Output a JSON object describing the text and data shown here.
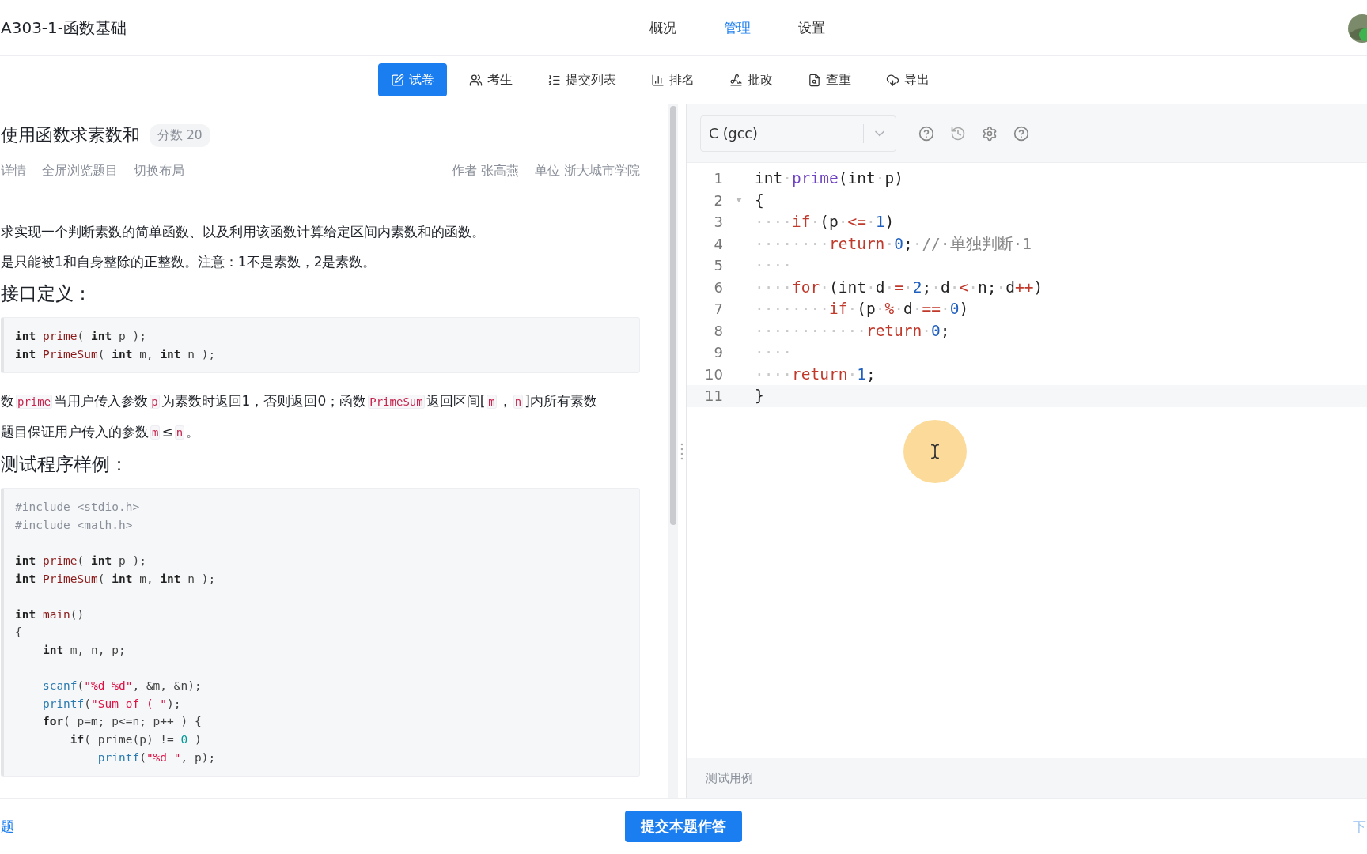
{
  "header": {
    "title": "A303-1-函数基础",
    "nav": [
      {
        "label": "概况",
        "selected": false
      },
      {
        "label": "管理",
        "selected": true
      },
      {
        "label": "设置",
        "selected": false
      }
    ]
  },
  "subnav": [
    {
      "label": "试卷",
      "selected": true
    },
    {
      "label": "考生",
      "selected": false
    },
    {
      "label": "提交列表",
      "selected": false
    },
    {
      "label": "排名",
      "selected": false
    },
    {
      "label": "批改",
      "selected": false
    },
    {
      "label": "查重",
      "selected": false
    },
    {
      "label": "导出",
      "selected": false
    }
  ],
  "problem": {
    "title": "使用函数求素数和",
    "score": "分数 20",
    "links": [
      "详情",
      "全屏浏览题目",
      "切换布局"
    ],
    "author": "作者 张高燕",
    "unit": "单位 浙大城市学院",
    "blocks": [
      {
        "kind": "para",
        "segments": [
          {
            "kind": "text",
            "s": "求实现一个判断素数的简单函数、以及利用该函数计算给定区间内素数和的函数。"
          }
        ]
      },
      {
        "kind": "para",
        "segments": [
          {
            "kind": "text",
            "s": "是只能被1和自身整除的正整数。注意：1不是素数，2是素数。"
          }
        ]
      },
      {
        "kind": "heading",
        "s": "接口定义："
      },
      {
        "kind": "code",
        "groups": [
          [
            [
              {
                "kind": "type",
                "s": "int"
              },
              {
                "kind": "name",
                "s": " prime"
              },
              {
                "kind": "plain",
                "s": "( "
              },
              {
                "kind": "type",
                "s": "int"
              },
              {
                "kind": "plain",
                "s": " p );"
              }
            ],
            [
              {
                "kind": "type",
                "s": "int"
              },
              {
                "kind": "name",
                "s": " PrimeSum"
              },
              {
                "kind": "plain",
                "s": "( "
              },
              {
                "kind": "type",
                "s": "int"
              },
              {
                "kind": "plain",
                "s": " m, "
              },
              {
                "kind": "type",
                "s": "int"
              },
              {
                "kind": "plain",
                "s": " n );"
              }
            ]
          ]
        ]
      },
      {
        "kind": "para",
        "segments": [
          {
            "kind": "text",
            "s": "数"
          },
          {
            "kind": "code",
            "s": "prime"
          },
          {
            "kind": "text",
            "s": "当用户传入参数"
          },
          {
            "kind": "code",
            "s": "p"
          },
          {
            "kind": "text",
            "s": "为素数时返回1，否则返回0；函数"
          },
          {
            "kind": "code",
            "s": "PrimeSum"
          },
          {
            "kind": "text",
            "s": "返回区间["
          },
          {
            "kind": "code",
            "s": "m"
          },
          {
            "kind": "text",
            "s": "，"
          },
          {
            "kind": "code",
            "s": "n"
          },
          {
            "kind": "text",
            "s": "]内所有素数"
          }
        ]
      },
      {
        "kind": "para",
        "segments": [
          {
            "kind": "text",
            "s": "题目保证用户传入的参数"
          },
          {
            "kind": "code",
            "s": "m"
          },
          {
            "kind": "text",
            "s": "≤"
          },
          {
            "kind": "code",
            "s": "n"
          },
          {
            "kind": "text",
            "s": "。"
          }
        ]
      },
      {
        "kind": "heading",
        "s": "测试程序样例："
      },
      {
        "kind": "code",
        "groups": [
          [
            [
              {
                "kind": "pre",
                "s": "#include <stdio.h>"
              }
            ],
            [
              {
                "kind": "pre",
                "s": "#include <math.h>"
              }
            ]
          ],
          [
            [
              {
                "kind": "type",
                "s": "int"
              },
              {
                "kind": "name",
                "s": " prime"
              },
              {
                "kind": "plain",
                "s": "( "
              },
              {
                "kind": "type",
                "s": "int"
              },
              {
                "kind": "plain",
                "s": " p );"
              }
            ],
            [
              {
                "kind": "type",
                "s": "int"
              },
              {
                "kind": "name",
                "s": " PrimeSum"
              },
              {
                "kind": "plain",
                "s": "( "
              },
              {
                "kind": "type",
                "s": "int"
              },
              {
                "kind": "plain",
                "s": " m, "
              },
              {
                "kind": "type",
                "s": "int"
              },
              {
                "kind": "plain",
                "s": " n );"
              }
            ]
          ],
          [
            [
              {
                "kind": "type",
                "s": "int"
              },
              {
                "kind": "name",
                "s": " main"
              },
              {
                "kind": "plain",
                "s": "()"
              }
            ],
            [
              {
                "kind": "plain",
                "s": "{"
              }
            ],
            [
              {
                "kind": "type",
                "s": "    int"
              },
              {
                "kind": "plain",
                "s": " m, n, p;"
              }
            ]
          ],
          [
            [
              {
                "kind": "builtin",
                "s": "    scanf"
              },
              {
                "kind": "plain",
                "s": "("
              },
              {
                "kind": "string",
                "s": "\"%d %d\""
              },
              {
                "kind": "plain",
                "s": ", &m, &n);"
              }
            ],
            [
              {
                "kind": "builtin",
                "s": "    printf"
              },
              {
                "kind": "plain",
                "s": "("
              },
              {
                "kind": "string",
                "s": "\"Sum of ( \""
              },
              {
                "kind": "plain",
                "s": ");"
              }
            ],
            [
              {
                "kind": "type",
                "s": "    for"
              },
              {
                "kind": "plain",
                "s": "( p=m; p<=n; p++ ) {"
              }
            ],
            [
              {
                "kind": "type",
                "s": "        if"
              },
              {
                "kind": "plain",
                "s": "( prime(p) != "
              },
              {
                "kind": "number",
                "s": "0"
              },
              {
                "kind": "plain",
                "s": " )"
              }
            ],
            [
              {
                "kind": "builtin",
                "s": "            printf"
              },
              {
                "kind": "plain",
                "s": "("
              },
              {
                "kind": "string",
                "s": "\"%d \""
              },
              {
                "kind": "plain",
                "s": ", p);"
              }
            ]
          ]
        ]
      }
    ]
  },
  "editor": {
    "language": "C (gcc)",
    "lines": [
      {
        "n": "1",
        "fold": false,
        "active": false,
        "tokens": [
          {
            "kind": "plain",
            "s": "int"
          },
          {
            "kind": "space",
            "s": "·"
          },
          {
            "kind": "name",
            "s": "prime"
          },
          {
            "kind": "plain",
            "s": "(int"
          },
          {
            "kind": "space",
            "s": "·"
          },
          {
            "kind": "plain",
            "s": "p)"
          }
        ]
      },
      {
        "n": "2",
        "fold": true,
        "active": false,
        "tokens": [
          {
            "kind": "plain",
            "s": "{"
          }
        ]
      },
      {
        "n": "3",
        "fold": false,
        "active": false,
        "tokens": [
          {
            "kind": "space",
            "s": "····"
          },
          {
            "kind": "keyword",
            "s": "if"
          },
          {
            "kind": "space",
            "s": "·"
          },
          {
            "kind": "plain",
            "s": "(p"
          },
          {
            "kind": "space",
            "s": "·"
          },
          {
            "kind": "keyword",
            "s": "<="
          },
          {
            "kind": "space",
            "s": "·"
          },
          {
            "kind": "number",
            "s": "1"
          },
          {
            "kind": "plain",
            "s": ")"
          }
        ]
      },
      {
        "n": "4",
        "fold": false,
        "active": false,
        "tokens": [
          {
            "kind": "space",
            "s": "········"
          },
          {
            "kind": "keyword",
            "s": "return"
          },
          {
            "kind": "space",
            "s": "·"
          },
          {
            "kind": "number",
            "s": "0"
          },
          {
            "kind": "plain",
            "s": ";"
          },
          {
            "kind": "space",
            "s": "·"
          },
          {
            "kind": "comment",
            "s": "//·单独判断·1"
          }
        ]
      },
      {
        "n": "5",
        "fold": false,
        "active": false,
        "tokens": [
          {
            "kind": "space",
            "s": "····"
          }
        ]
      },
      {
        "n": "6",
        "fold": false,
        "active": false,
        "tokens": [
          {
            "kind": "space",
            "s": "····"
          },
          {
            "kind": "keyword",
            "s": "for"
          },
          {
            "kind": "space",
            "s": "·"
          },
          {
            "kind": "plain",
            "s": "(int"
          },
          {
            "kind": "space",
            "s": "·"
          },
          {
            "kind": "plain",
            "s": "d"
          },
          {
            "kind": "space",
            "s": "·"
          },
          {
            "kind": "keyword",
            "s": "="
          },
          {
            "kind": "space",
            "s": "·"
          },
          {
            "kind": "number",
            "s": "2"
          },
          {
            "kind": "plain",
            "s": ";"
          },
          {
            "kind": "space",
            "s": "·"
          },
          {
            "kind": "plain",
            "s": "d"
          },
          {
            "kind": "space",
            "s": "·"
          },
          {
            "kind": "keyword",
            "s": "<"
          },
          {
            "kind": "space",
            "s": "·"
          },
          {
            "kind": "plain",
            "s": "n;"
          },
          {
            "kind": "space",
            "s": "·"
          },
          {
            "kind": "plain",
            "s": "d"
          },
          {
            "kind": "keyword",
            "s": "++"
          },
          {
            "kind": "plain",
            "s": ")"
          }
        ]
      },
      {
        "n": "7",
        "fold": false,
        "active": false,
        "tokens": [
          {
            "kind": "space",
            "s": "········"
          },
          {
            "kind": "keyword",
            "s": "if"
          },
          {
            "kind": "space",
            "s": "·"
          },
          {
            "kind": "plain",
            "s": "(p"
          },
          {
            "kind": "space",
            "s": "·"
          },
          {
            "kind": "keyword",
            "s": "%"
          },
          {
            "kind": "space",
            "s": "·"
          },
          {
            "kind": "plain",
            "s": "d"
          },
          {
            "kind": "space",
            "s": "·"
          },
          {
            "kind": "keyword",
            "s": "=="
          },
          {
            "kind": "space",
            "s": "·"
          },
          {
            "kind": "number",
            "s": "0"
          },
          {
            "kind": "plain",
            "s": ")"
          }
        ]
      },
      {
        "n": "8",
        "fold": false,
        "active": false,
        "tokens": [
          {
            "kind": "space",
            "s": "············"
          },
          {
            "kind": "keyword",
            "s": "return"
          },
          {
            "kind": "space",
            "s": "·"
          },
          {
            "kind": "number",
            "s": "0"
          },
          {
            "kind": "plain",
            "s": ";"
          }
        ]
      },
      {
        "n": "9",
        "fold": false,
        "active": false,
        "tokens": [
          {
            "kind": "space",
            "s": "····"
          }
        ]
      },
      {
        "n": "10",
        "fold": false,
        "active": false,
        "tokens": [
          {
            "kind": "space",
            "s": "····"
          },
          {
            "kind": "keyword",
            "s": "return"
          },
          {
            "kind": "space",
            "s": "·"
          },
          {
            "kind": "number",
            "s": "1"
          },
          {
            "kind": "plain",
            "s": ";"
          }
        ]
      },
      {
        "n": "11",
        "fold": false,
        "active": true,
        "tokens": [
          {
            "kind": "plain",
            "s": "}"
          }
        ]
      }
    ],
    "testcases": "测试用例"
  },
  "footer": {
    "prev": "题",
    "submit": "提交本题作答",
    "next": "下"
  }
}
